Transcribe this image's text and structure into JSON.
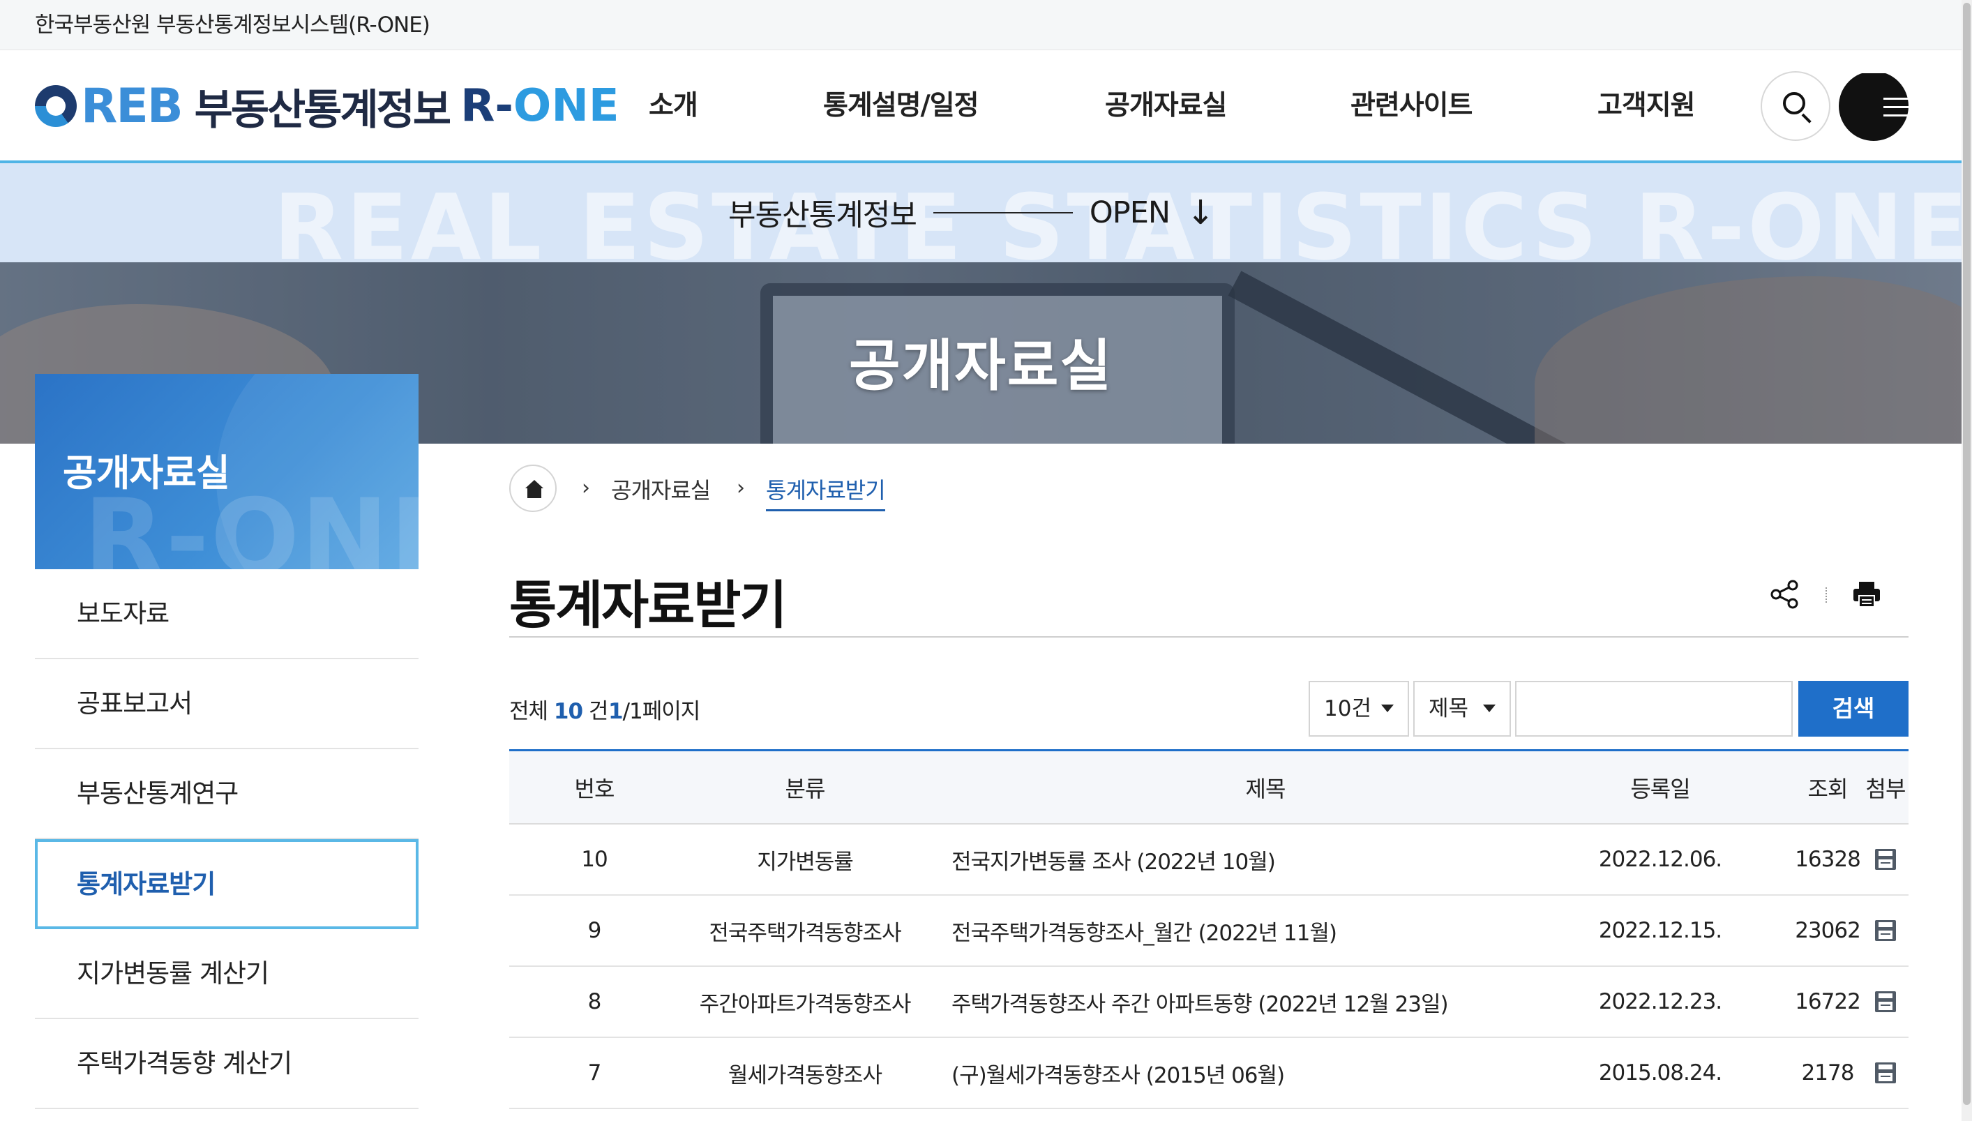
{
  "topbar": {
    "text": "한국부동산원 부동산통계정보시스템(R-ONE)"
  },
  "logo": {
    "reb": "REB",
    "kor": "부동산통계정보",
    "rone_r": "R-",
    "rone_one": "ONE"
  },
  "nav": {
    "items": [
      "소개",
      "통계설명/일정",
      "공개자료실",
      "관련사이트",
      "고객지원"
    ]
  },
  "open_strip": {
    "background_text": "REAL ESTATE STATISTICS R-ONE",
    "label": "부동산통계정보",
    "open": "OPEN",
    "arrow": "↓"
  },
  "hero": {
    "title": "공개자료실"
  },
  "sidebar": {
    "title": "공개자료실",
    "watermark": "R-ONE",
    "items": [
      "보도자료",
      "공표보고서",
      "부동산통계연구",
      "통계자료받기",
      "지가변동률 계산기",
      "주택가격동향 계산기"
    ],
    "active_index": 3
  },
  "breadcrumb": {
    "items": [
      "공개자료실",
      "통계자료받기"
    ]
  },
  "page": {
    "title": "통계자료받기"
  },
  "list_info": {
    "total_prefix": "전체",
    "total_count": "10",
    "total_suffix": "건",
    "page_current": "1",
    "page_rest": "/1페이지"
  },
  "search": {
    "page_size": "10건",
    "field": "제목",
    "query": "",
    "button": "검색"
  },
  "table": {
    "headers": {
      "no": "번호",
      "category": "분류",
      "title": "제목",
      "date": "등록일",
      "views": "조회",
      "attach": "첨부"
    },
    "rows": [
      {
        "no": "10",
        "category": "지가변동률",
        "title": "전국지가변동률 조사 (2022년 10월)",
        "date": "2022.12.06.",
        "views": "16328"
      },
      {
        "no": "9",
        "category": "전국주택가격동향조사",
        "title": "전국주택가격동향조사_월간 (2022년 11월)",
        "date": "2022.12.15.",
        "views": "23062"
      },
      {
        "no": "8",
        "category": "주간아파트가격동향조사",
        "title": "주택가격동향조사 주간 아파트동향 (2022년 12월 23일)",
        "date": "2022.12.23.",
        "views": "16722"
      },
      {
        "no": "7",
        "category": "월세가격동향조사",
        "title": "(구)월세가격동향조사 (2015년 06월)",
        "date": "2015.08.24.",
        "views": "2178"
      }
    ]
  },
  "icons": {
    "search": "search-icon",
    "menu": "menu-icon",
    "home": "home-icon",
    "share": "share-icon",
    "print": "print-icon",
    "attach": "attachment-icon"
  },
  "colors": {
    "accent": "#1f6fc9",
    "link": "#1f5fae",
    "header_rule": "#4fb4e6",
    "strip": "#d7e5f7"
  }
}
